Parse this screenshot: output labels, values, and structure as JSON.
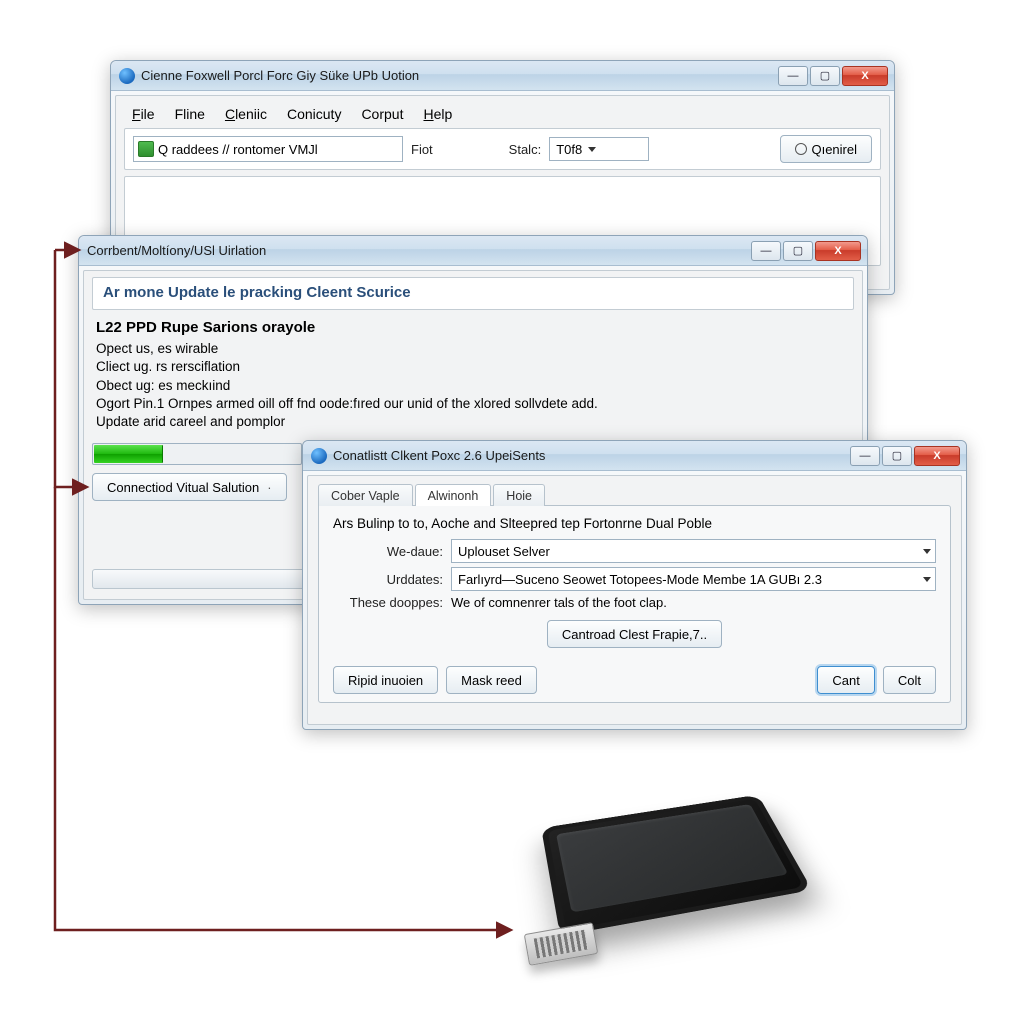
{
  "window1": {
    "title": "Cienne Foxwell Porcl Forc Giy Süke UPb Uotion",
    "menu": {
      "file": "File",
      "fline": "Fline",
      "clenic": "Cleniic",
      "conicuty": "Conicuty",
      "corput": "Corput",
      "help": "Help"
    },
    "toolbar": {
      "address_value": "Q raddees // rontomer VMJl",
      "fiot_label": "Fiot",
      "stalc_label": "Stalc:",
      "stalc_value": "T0f8",
      "submit_label": "Qıenirel"
    }
  },
  "window2": {
    "title": "Corrbent/Moltíony/USl Uirlation",
    "tab_label": "Ar mone Update le pracking Cleent Scurice",
    "messages": {
      "bold": "L22 PPD Rupe Sarions orayole",
      "l1": "Opect us, es wirable",
      "l2": "Cliect ug. rs rersciflation",
      "l3": "Obect ug: es meckıind",
      "l4": "Ogort Pin.1 Ornpes armed oill off fnd oode:fıred our unid of the xlored sollvdete add.",
      "l5": "Update arid careel and pomplor"
    },
    "progress_percent": 33,
    "button_label": "Connectiod Vitual Salution"
  },
  "window3": {
    "title": "Conatlistt Clkent Poxc 2.6 UpeiSents",
    "tabs": {
      "t1": "Cober Vaple",
      "t2": "Alwinonh",
      "t3": "Hoie"
    },
    "heading": "Ars Bulinp to to, Aoche and Slteepred tep Fortonrne Dual Poble",
    "label_wedaue": "We-daue:",
    "value_wedaue": "Uplouset Selver",
    "label_urddates": "Urddates:",
    "value_urddates": "Farlıyrd—Suceno Seowet Totopees-Mode Membe 1A GUBı 2.3",
    "note_label": "These dooppes:",
    "note_value": "We of comnenrer tals of the foot clap.",
    "center_button": "Cantroad Clest Frapie,7..",
    "buttons": {
      "left1": "Ripid inuoien",
      "left2": "Mask reed",
      "right1": "Cant",
      "right2": "Colt"
    }
  }
}
